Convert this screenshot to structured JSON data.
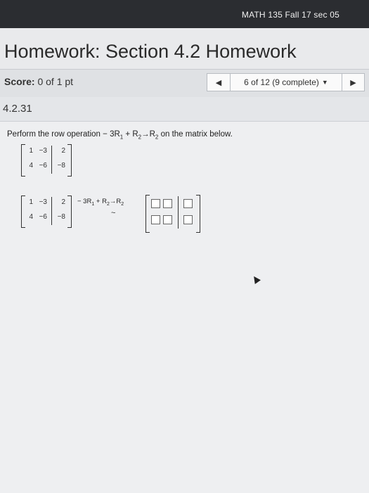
{
  "header": {
    "course": "MATH 135 Fall 17 sec 05"
  },
  "page": {
    "title": "Homework: Section 4.2 Homework"
  },
  "score": {
    "label": "Score:",
    "value": "0 of 1 pt"
  },
  "nav": {
    "prev_icon": "◀",
    "progress": "6 of 12 (9 complete)",
    "dropdown_icon": "▼",
    "next_icon": "▶"
  },
  "question": {
    "number": "4.2.31",
    "prompt_text": "Perform the row operation",
    "op_a": "− 3R",
    "op_a_sub": "1",
    "op_b": " + R",
    "op_b_sub": "2",
    "op_c": "→R",
    "op_c_sub": "2",
    "prompt_tail": "on the matrix below.",
    "matrix": [
      [
        "1",
        "−3",
        "2"
      ],
      [
        "4",
        "−6",
        "−8"
      ]
    ],
    "step_matrix": [
      [
        "1",
        "−3",
        "2"
      ],
      [
        "4",
        "−6",
        "−8"
      ]
    ],
    "step_op": {
      "a": "− 3R",
      "a_sub": "1",
      "b": " + R",
      "b_sub": "2",
      "c": "→R",
      "c_sub": "2"
    },
    "tilde": "~"
  }
}
